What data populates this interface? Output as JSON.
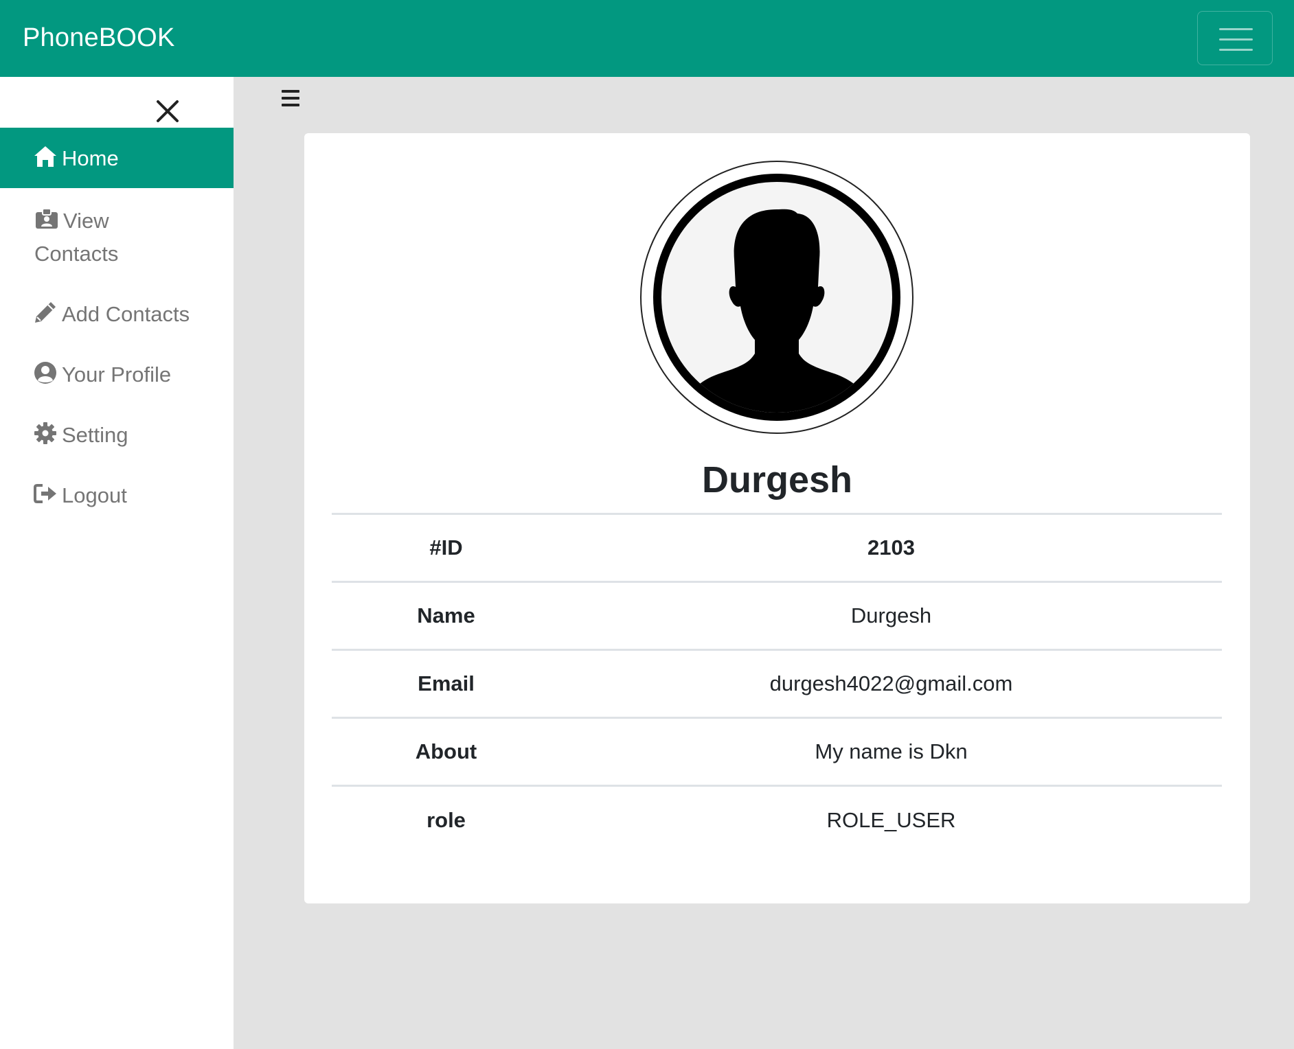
{
  "app": {
    "brand": "PhoneBOOK"
  },
  "sidebar": {
    "items": [
      {
        "label": "Home",
        "icon": "home-icon",
        "active": true
      },
      {
        "label_line1": "View",
        "label_line2": "Contacts",
        "icon": "id-badge-icon"
      },
      {
        "label": "Add Contacts",
        "icon": "pencil-icon"
      },
      {
        "label": "Your Profile",
        "icon": "user-circle-icon"
      },
      {
        "label": "Setting",
        "icon": "gear-icon"
      },
      {
        "label": "Logout",
        "icon": "sign-out-icon"
      }
    ]
  },
  "profile": {
    "name": "Durgesh",
    "rows": [
      {
        "key": "#ID",
        "value": "2103"
      },
      {
        "key": "Name",
        "value": "Durgesh"
      },
      {
        "key": "Email",
        "value": "durgesh4022@gmail.com"
      },
      {
        "key": "About",
        "value": "My name is Dkn"
      },
      {
        "key": "role",
        "value": "ROLE_USER"
      }
    ]
  },
  "colors": {
    "brand": "#029880",
    "page_bg": "#e2e2e2",
    "muted_text": "#757575"
  }
}
